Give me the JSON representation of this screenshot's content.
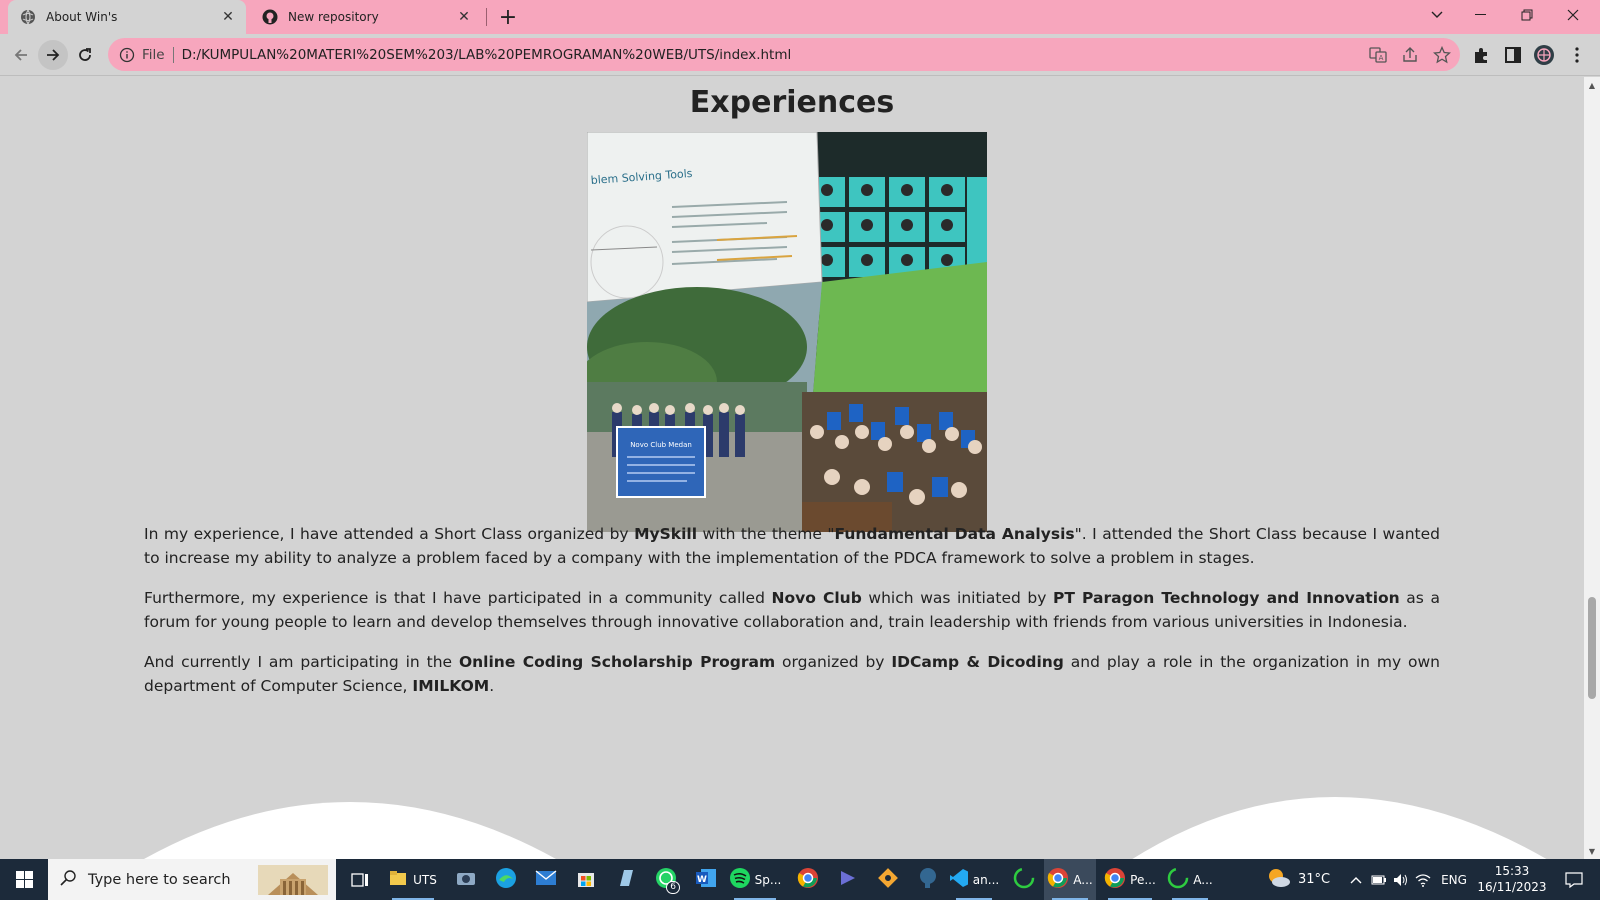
{
  "browser": {
    "tabs": [
      {
        "title": "About Win's",
        "active": true,
        "icon": "globe-icon"
      },
      {
        "title": "New repository",
        "active": false,
        "icon": "github-icon"
      }
    ],
    "omnibox": {
      "scheme_label": "File",
      "url": "D:/KUMPULAN%20MATERI%20SEM%203/LAB%20PEMROGRAMAN%20WEB/UTS/index.html"
    }
  },
  "page": {
    "section_title": "Experiences",
    "paragraphs": [
      {
        "p1_a": "In my experience, I have attended a Short Class organized by ",
        "p1_b": "MySkill",
        "p1_c": " with the theme \"",
        "p1_d": "Fundamental Data Analysis",
        "p1_e": "\". I attended the Short Class because I wanted to increase my ability to analyze a problem faced by a company with the implementation of the PDCA framework to solve a problem in stages."
      },
      {
        "p2_a": "Furthermore, my experience is that I have participated in a community called ",
        "p2_b": "Novo Club",
        "p2_c": " which was initiated by ",
        "p2_d": "PT Paragon Technology and Innovation",
        "p2_e": " as a forum for young people to learn and develop themselves through innovative collaboration and, train leadership with friends from various universities in Indonesia."
      },
      {
        "p3_a": "And currently I am participating in the ",
        "p3_b": "Online Coding Scholarship Program",
        "p3_c": " organized by ",
        "p3_d": "IDCamp & Dicoding",
        "p3_e": " and play a role in the organization in my own department of Computer Science, ",
        "p3_f": "IMILKOM",
        "p3_g": "."
      }
    ],
    "photo": {
      "slide_heading": "blem Solving Tools",
      "banner_title": "Novo Club Medan"
    }
  },
  "taskbar": {
    "search_placeholder": "Type here to search",
    "apps": [
      {
        "label": "UTS",
        "icon": "folder-icon"
      },
      {
        "label": "",
        "icon": "camera-icon"
      },
      {
        "label": "",
        "icon": "edge-icon"
      },
      {
        "label": "",
        "icon": "mail-icon"
      },
      {
        "label": "",
        "icon": "store-icon"
      },
      {
        "label": "",
        "icon": "notepad-icon"
      },
      {
        "label": "",
        "icon": "whatsapp-icon",
        "badge": "6"
      },
      {
        "label": "",
        "icon": "word-icon"
      },
      {
        "label": "Sp...",
        "icon": "spotify-icon"
      },
      {
        "label": "",
        "icon": "chrome-icon"
      },
      {
        "label": "",
        "icon": "app-icon"
      },
      {
        "label": "",
        "icon": "git-icon"
      },
      {
        "label": "",
        "icon": "postgres-icon"
      },
      {
        "label": "an...",
        "icon": "vscode-icon"
      },
      {
        "label": "",
        "icon": "loading-icon"
      },
      {
        "label": "A...",
        "icon": "chrome-icon"
      },
      {
        "label": "Pe...",
        "icon": "chrome-icon"
      },
      {
        "label": "A...",
        "icon": "loading-icon"
      }
    ],
    "weather": "31°C",
    "language": "ENG",
    "time": "15:33",
    "date": "16/11/2023"
  },
  "colors": {
    "tab_strip": "#f7a6bd",
    "page_background": "#d3d3d3",
    "taskbar": "#1c2a3a"
  }
}
